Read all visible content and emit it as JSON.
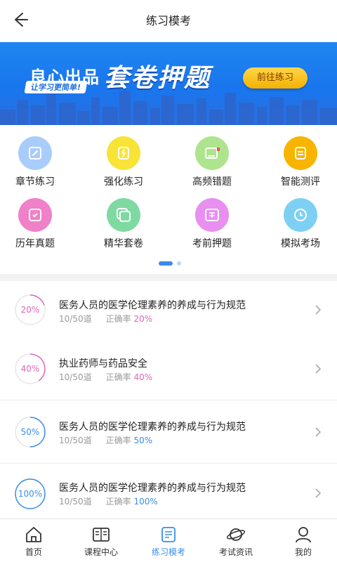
{
  "header": {
    "title": "练习模考"
  },
  "banner": {
    "brand": "良心出品",
    "slogan": "让学习更简单!",
    "headline": "套卷押题",
    "cta_label": "前往练习"
  },
  "grid": {
    "items": [
      {
        "label": "章节练习",
        "icon": "pencil-icon",
        "color": "#a9cdfb",
        "fg": "#ffffff"
      },
      {
        "label": "强化练习",
        "icon": "lightning-icon",
        "color": "#f8e337",
        "fg": "#ffffff"
      },
      {
        "label": "高频错题",
        "icon": "book-flag-icon",
        "color": "#aee48d",
        "fg": "#ffffff"
      },
      {
        "label": "智能测评",
        "icon": "document-icon",
        "color": "#f7b400",
        "fg": "#ffffff"
      },
      {
        "label": "历年真题",
        "icon": "paper-check-icon",
        "color": "#f080c8",
        "fg": "#ffffff"
      },
      {
        "label": "精华套卷",
        "icon": "stack-icon",
        "color": "#7fdaa1",
        "fg": "#ffffff"
      },
      {
        "label": "考前押题",
        "icon": "seal-icon",
        "color": "#e88ff0",
        "fg": "#ffffff"
      },
      {
        "label": "模拟考场",
        "icon": "clock-icon",
        "color": "#7dd0f3",
        "fg": "#ffffff"
      }
    ]
  },
  "list": {
    "rows": [
      {
        "progress_pct": 20,
        "progress_label": "20%",
        "title": "医务人员的医学伦理素养的养成与行为规范",
        "count": "10/50道",
        "rate_label": "正确率",
        "rate_value": "20%",
        "color": "#e066b8"
      },
      {
        "progress_pct": 40,
        "progress_label": "40%",
        "title": "执业药师与药品安全",
        "count": "10/50道",
        "rate_label": "正确率",
        "rate_value": "40%",
        "color": "#e066b8"
      },
      {
        "progress_pct": 50,
        "progress_label": "50%",
        "title": "医务人员的医学伦理素养的养成与行为规范",
        "count": "10/50道",
        "rate_label": "正确率",
        "rate_value": "50%",
        "color": "#3a8ee6"
      },
      {
        "progress_pct": 100,
        "progress_label": "100%",
        "title": "医务人员的医学伦理素养的养成与行为规范",
        "count": "10/50道",
        "rate_label": "正确率",
        "rate_value": "100%",
        "color": "#3a8ee6"
      }
    ]
  },
  "tabbar": {
    "tabs": [
      {
        "label": "首页",
        "icon": "home-icon",
        "active": false
      },
      {
        "label": "课程中心",
        "icon": "book-icon",
        "active": false
      },
      {
        "label": "练习模考",
        "icon": "exam-icon",
        "active": true
      },
      {
        "label": "考试资讯",
        "icon": "planet-icon",
        "active": false
      },
      {
        "label": "我的",
        "icon": "user-icon",
        "active": false
      }
    ],
    "active_color": "#3a8ee6"
  }
}
